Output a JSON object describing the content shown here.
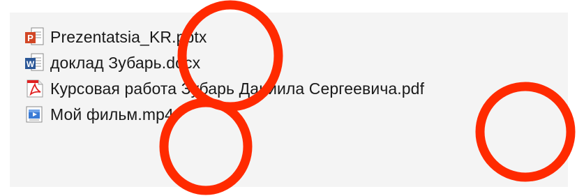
{
  "files": [
    {
      "name": "Prezentatsia_KR.pptx",
      "icon": "powerpoint-file-icon",
      "accent": "#d24726"
    },
    {
      "name": "доклад Зубарь.docx",
      "icon": "word-file-icon",
      "accent": "#2b5797"
    },
    {
      "name": "Курсовая работа Зубарь Даниила Сергеевича.pdf",
      "icon": "pdf-file-icon",
      "accent": "#e02020"
    },
    {
      "name": "Мой фильм.mp4",
      "icon": "video-file-icon",
      "accent": "#3a7bd5"
    }
  ],
  "annotation_color": "#ff2a00"
}
